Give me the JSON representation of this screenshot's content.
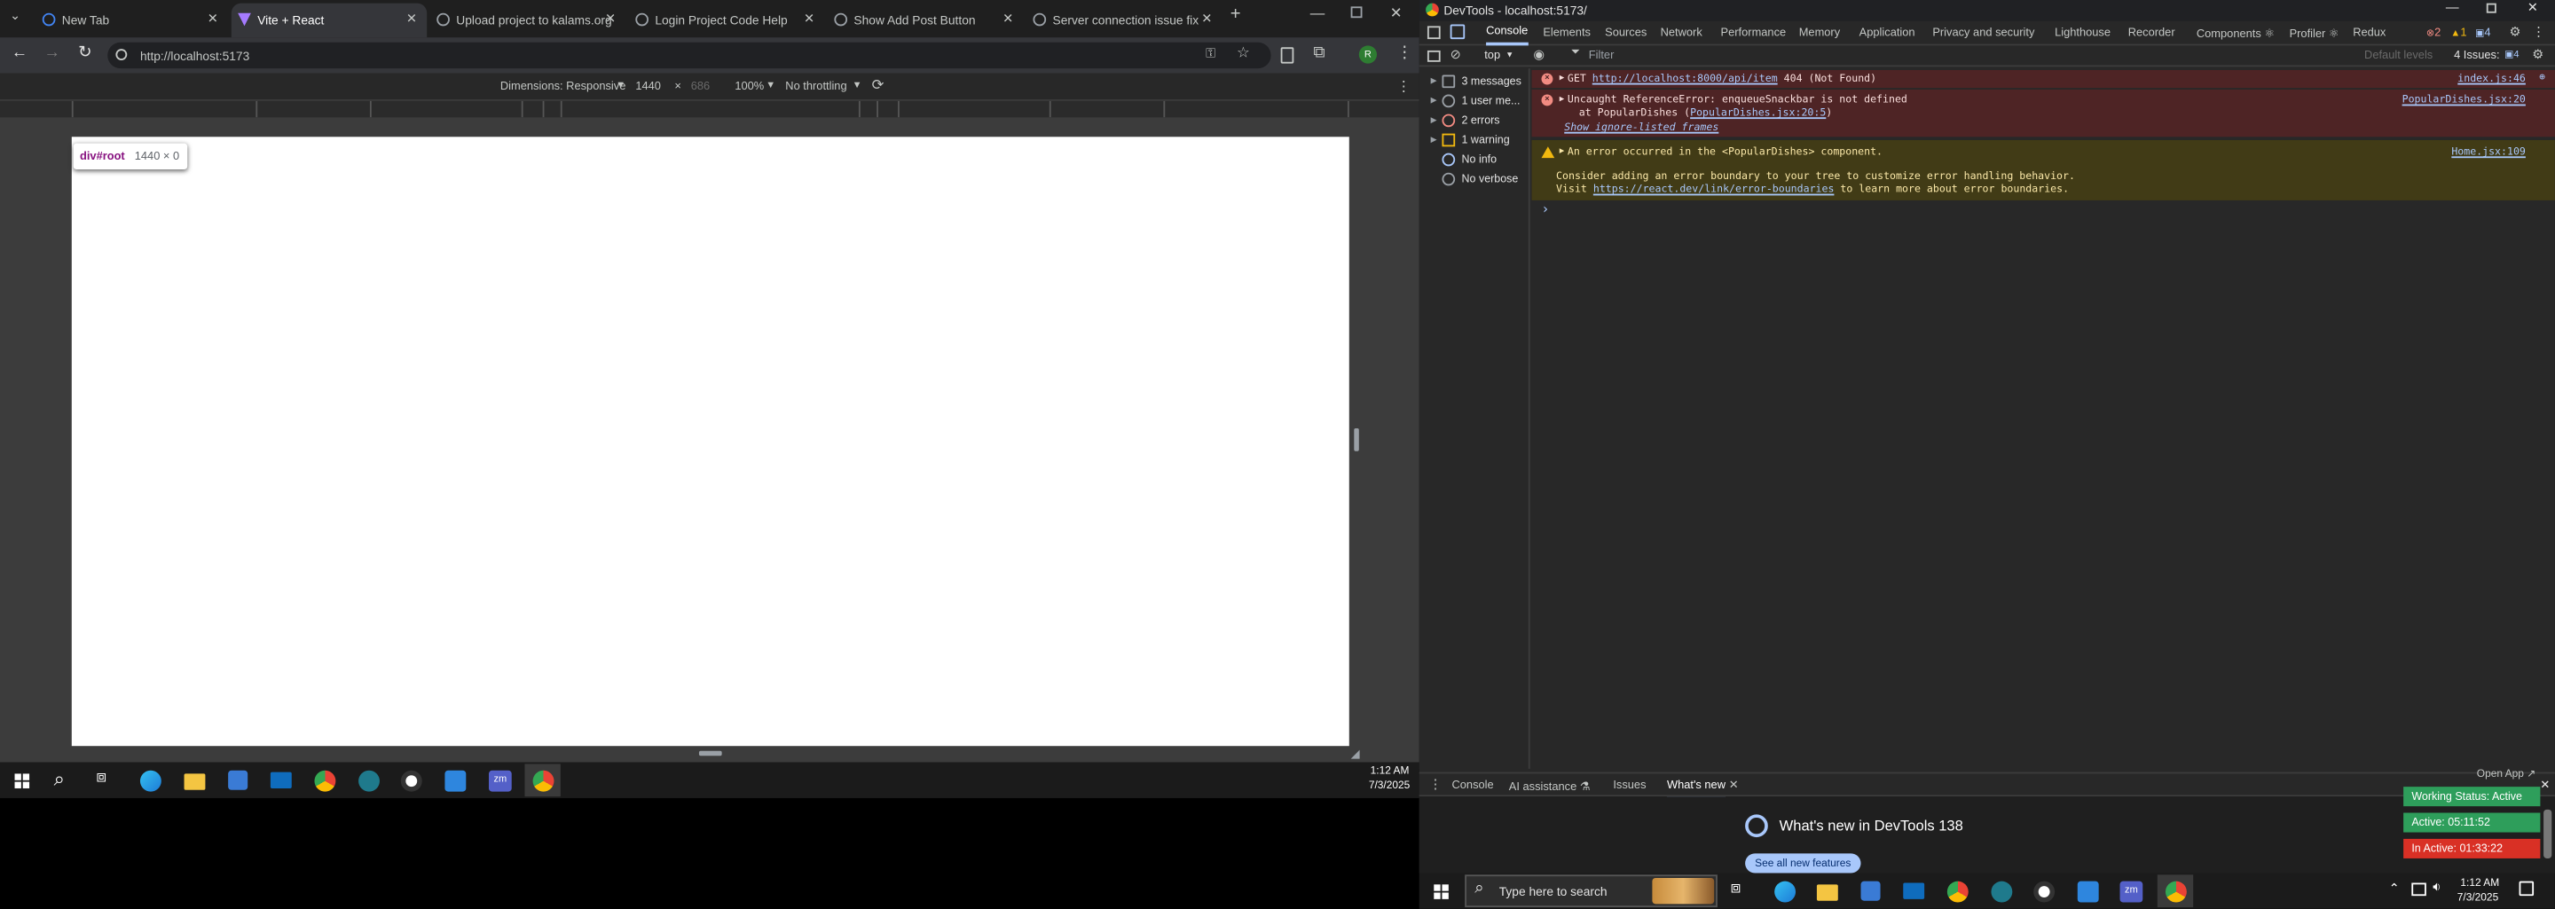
{
  "browser": {
    "tabs": [
      {
        "label": "New Tab"
      },
      {
        "label": "Vite + React"
      },
      {
        "label": "Upload project to kalams.org"
      },
      {
        "label": "Login Project Code Help"
      },
      {
        "label": "Show Add Post Button"
      },
      {
        "label": "Server connection issue fix"
      }
    ],
    "new_tab_glyph": "+",
    "url": "http://localhost:5173",
    "device_toolbar": {
      "dimensions_label": "Dimensions: Responsive",
      "width": "1440",
      "height": "686",
      "times": "×",
      "zoom": "100%",
      "throttling": "No throttling"
    },
    "page_tooltip": {
      "selector": "div#root",
      "size": "1440 × 0"
    },
    "avatar_letter": "R"
  },
  "clock_left": {
    "time": "1:12 AM",
    "date": "7/3/2025"
  },
  "devtools": {
    "title": "DevTools - localhost:5173/",
    "tabs": [
      "Console",
      "Elements",
      "Sources",
      "Network",
      "Performance",
      "Memory",
      "Application",
      "Privacy and security",
      "Lighthouse",
      "Recorder",
      "Components ⚛",
      "Profiler ⚛",
      "Redux"
    ],
    "counts": {
      "errors": "2",
      "warnings": "1",
      "issues_prefix": "1",
      "issues": "4"
    },
    "context": "top",
    "filter_placeholder": "Filter",
    "default_levels": "Default levels",
    "issues_label": "4 Issues:",
    "sidebar": [
      {
        "label": "3 messages"
      },
      {
        "label": "1 user me..."
      },
      {
        "label": "2 errors"
      },
      {
        "label": "1 warning"
      },
      {
        "label": "No info"
      },
      {
        "label": "No verbose"
      }
    ],
    "console": {
      "row1": {
        "method": "GET",
        "url": "http://localhost:8000/api/item",
        "status": "404 (Not Found)",
        "source": "index.js:46"
      },
      "row2": {
        "text": "Uncaught ReferenceError: enqueueSnackbar is not defined",
        "at_prefix": "at PopularDishes (",
        "at_link": "PopularDishes.jsx:20:5",
        "at_suffix": ")",
        "ignore": "Show ignore-listed frames",
        "source": "PopularDishes.jsx:20"
      },
      "row3": {
        "text": "An error occurred in the <PopularDishes> component.",
        "line2": "Consider adding an error boundary to your tree to customize error handling behavior.",
        "visit": "Visit",
        "link": "https://react.dev/link/error-boundaries",
        "after": "to learn more about error boundaries.",
        "source": "Home.jsx:109"
      },
      "prompt": "›"
    },
    "drawer_tabs": [
      "Console",
      "AI assistance ⚗",
      "Issues",
      "What's new"
    ],
    "whats_new_title": "What's new in DevTools 138",
    "see_all": "See all new features",
    "open_app": "Open App ↗"
  },
  "status_overlay": {
    "working": "Working Status: Active",
    "active": "Active: 05:11:52",
    "inactive": "In Active: 01:33:22"
  },
  "taskbar": {
    "search_placeholder": "Type here to search",
    "time": "1:12 AM",
    "date": "7/3/2025"
  },
  "colors": {
    "accent": "#a8c7fa",
    "error_bg": "#4e2425",
    "warn_bg": "#413b16",
    "status_green": "#2e9e5b",
    "status_red": "#d93025"
  }
}
